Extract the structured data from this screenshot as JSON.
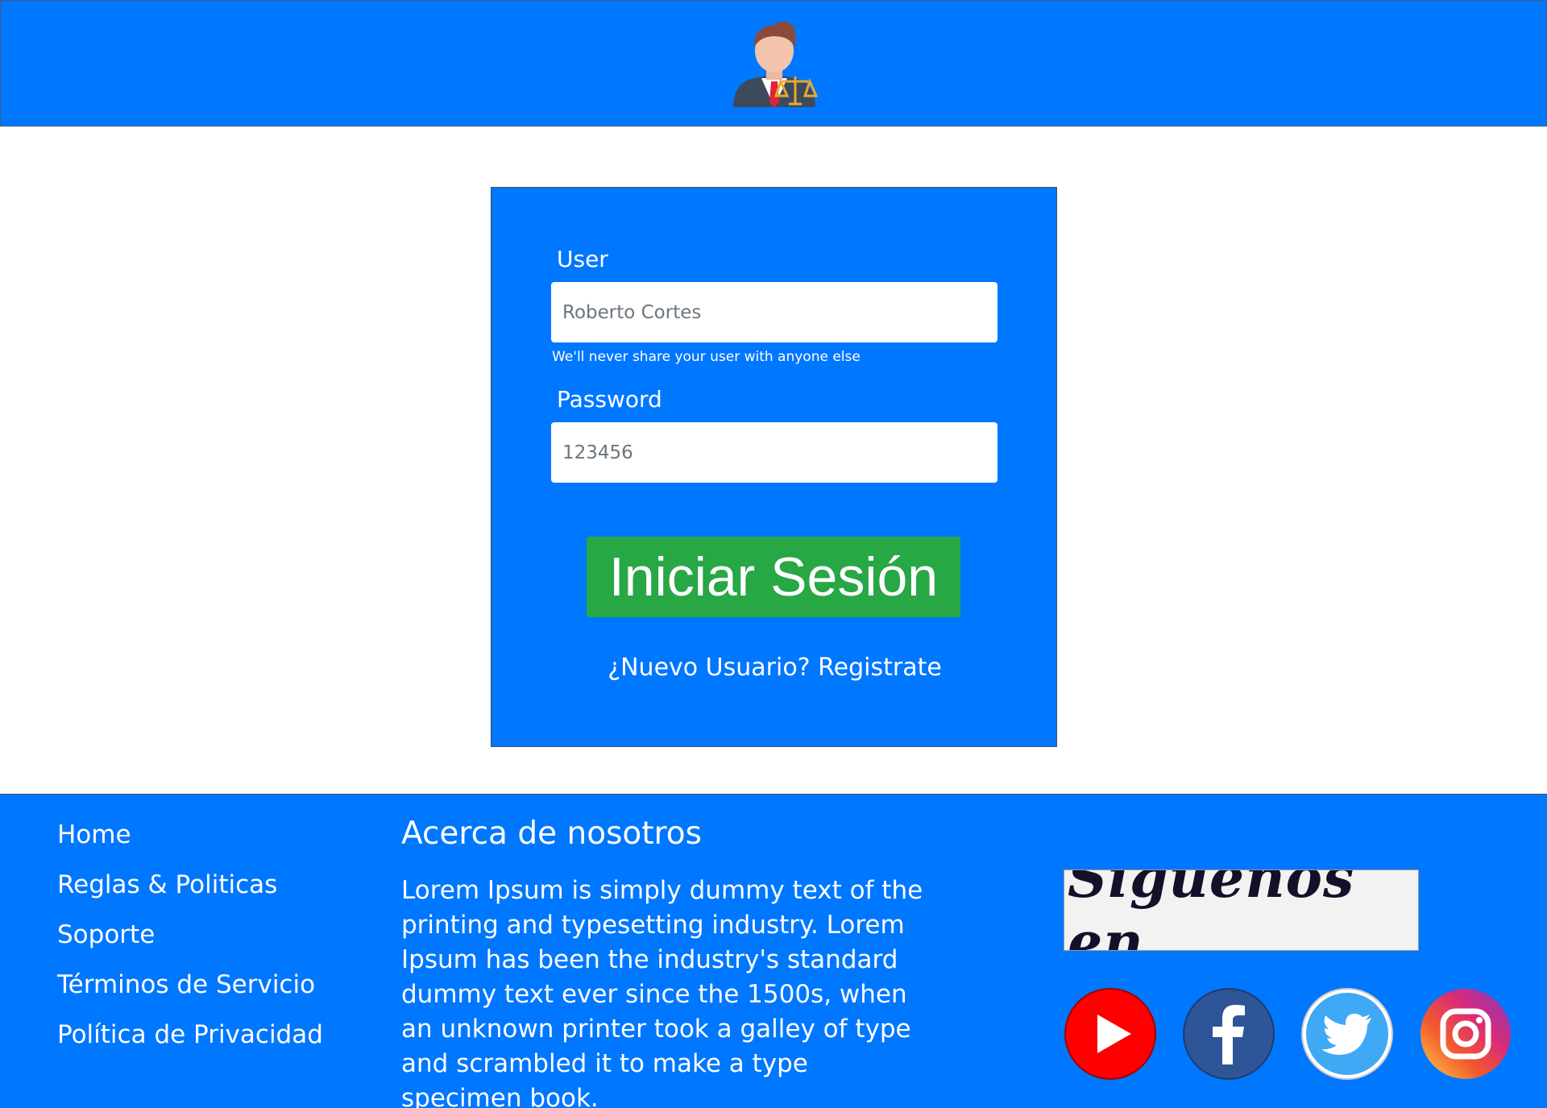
{
  "header": {
    "logo_icon": "lawyer-avatar-icon"
  },
  "login": {
    "user_label": "User",
    "user_placeholder": "Roberto Cortes",
    "user_help": "We'll never share your user with anyone else",
    "password_label": "Password",
    "password_placeholder": "123456",
    "submit_label": "Iniciar Sesión",
    "register_link": "¿Nuevo Usuario? Registrate"
  },
  "footer": {
    "nav": [
      "Home",
      "Reglas & Politicas",
      "Soporte",
      "Términos de Servicio",
      "Política de Privacidad"
    ],
    "about_title": "Acerca de nosotros",
    "about_text": "Lorem Ipsum is simply dummy text of the printing and typesetting industry. Lorem Ipsum has been the industry's standard dummy text ever since the 1500s, when an unknown printer took a galley of type and scrambled it to make a type specimen book.",
    "follow_label": "Siguenos en",
    "social_icons": [
      "youtube-icon",
      "facebook-icon",
      "twitter-icon",
      "instagram-icon"
    ]
  },
  "colors": {
    "primary": "#0077ff",
    "success": "#28a745",
    "youtube": "#ff0000",
    "facebook": "#2d5597",
    "twitter": "#3fa9f5"
  }
}
